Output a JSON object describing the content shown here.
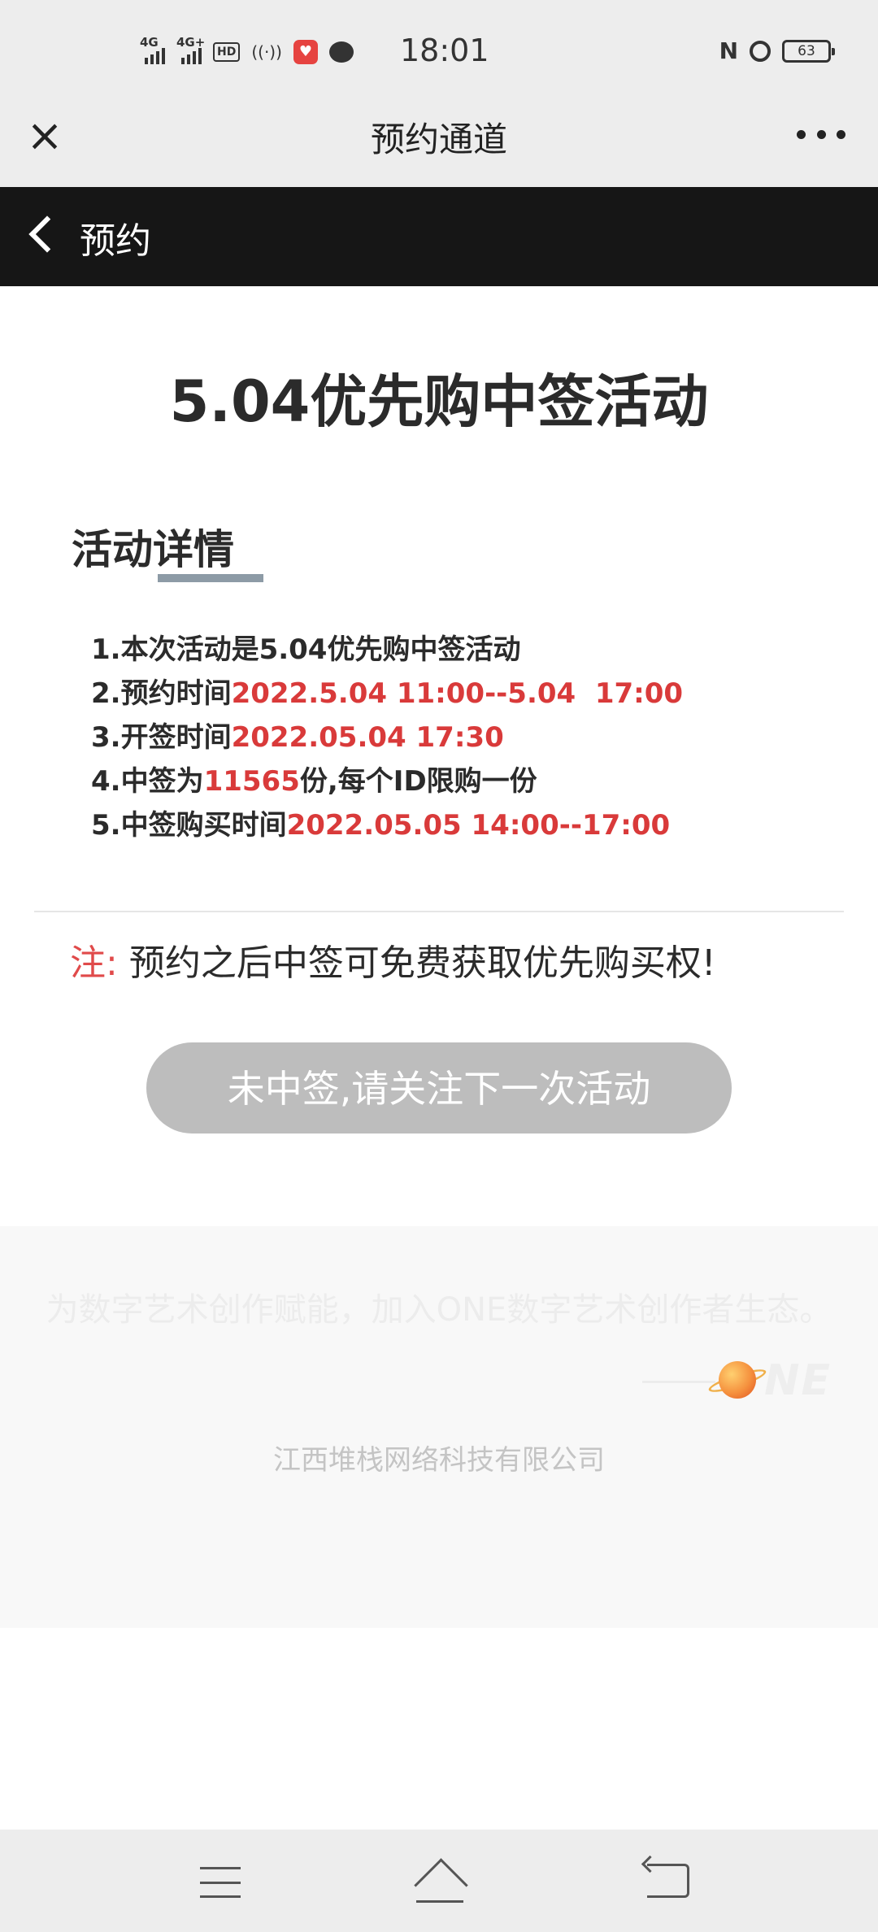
{
  "status_bar": {
    "signal1": "4G",
    "signal2": "4G+",
    "hd": "HD",
    "time": "18:01",
    "nfc": "N",
    "battery": "63"
  },
  "nav": {
    "title": "预约通道"
  },
  "page_header": {
    "title": "预约"
  },
  "main": {
    "title": "5.04优先购中签活动",
    "section_title": "活动详情",
    "details": [
      {
        "prefix": "1.本次活动是5.04优先购中签活动",
        "highlight": "",
        "suffix": ""
      },
      {
        "prefix": "2.预约时间",
        "highlight": "2022.5.04 11:00--5.04  17:00",
        "suffix": ""
      },
      {
        "prefix": "3.开签时间",
        "highlight": "2022.05.04 17:30",
        "suffix": ""
      },
      {
        "prefix": "4.中签为",
        "highlight": "11565",
        "suffix": "份,每个ID限购一份"
      },
      {
        "prefix": "5.中签购买时间",
        "highlight": "2022.05.05 14:00--17:00",
        "suffix": ""
      }
    ],
    "note_label": "注:",
    "note_text": "预约之后中签可免费获取优先购买权!",
    "cta_label": "未中签,请关注下一次活动"
  },
  "footer": {
    "slogan": "为数字艺术创作赋能，加入ONE数字艺术创作者生态。",
    "logo_text": "NE",
    "company": "江西堆栈网络科技有限公司"
  },
  "colors": {
    "highlight": "#d93a3a",
    "header_bg": "#161616",
    "button_bg": "#bdbdbd"
  }
}
